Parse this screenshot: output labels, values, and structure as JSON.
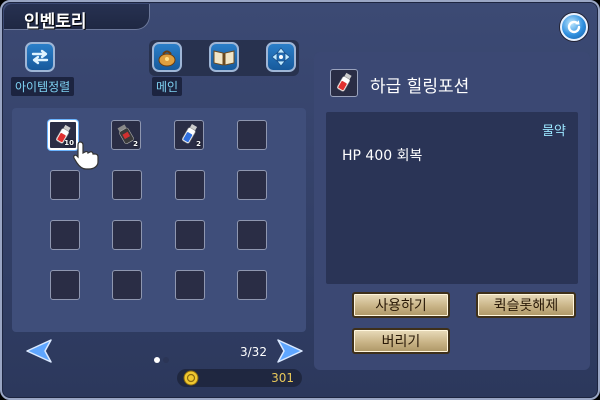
{
  "window": {
    "title": "인벤토리",
    "sort_label": "아이템정렬",
    "main_label": "메인"
  },
  "icons": {
    "refresh": "refresh-icon",
    "sort": "sort-arrows-icon",
    "bag": "bag-icon",
    "book": "book-icon",
    "move": "move-arrows-icon",
    "pointer": "hand-pointer-icon",
    "coin": "coin-icon"
  },
  "slots": [
    {
      "item": "red-potion",
      "qty": "10",
      "selected": true
    },
    {
      "item": "dark-potion",
      "qty": "2",
      "selected": false
    },
    {
      "item": "blue-potion",
      "qty": "2",
      "selected": false
    },
    {
      "item": "",
      "qty": "",
      "selected": false
    }
  ],
  "pagination": {
    "count": "3/32",
    "active_dot": 0,
    "total_dots": 2
  },
  "gold": {
    "amount": "301"
  },
  "detail": {
    "name": "하급 힐링포션",
    "category": "물약",
    "effect": "HP 400 회복"
  },
  "actions": {
    "use": "사용하기",
    "quickslot": "퀵슬롯해제",
    "discard": "버리기"
  },
  "colors": {
    "window_bg": "#323f66",
    "panel_bg": "#3f4e7a",
    "accent_cyan": "#7fd3f4",
    "gold": "#e8c85a"
  }
}
